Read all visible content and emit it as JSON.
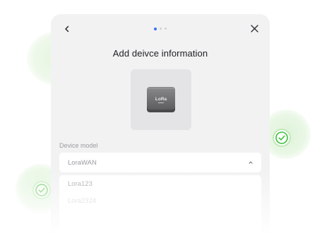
{
  "dialog": {
    "title": "Add deivce information",
    "steps": {
      "total": 3,
      "current": 1
    },
    "back_icon": "chevron-left-icon",
    "close_icon": "close-icon"
  },
  "device_image": {
    "chip_text": "LoRa",
    "colors": {
      "tile": "#e4e4e6",
      "chip": "#6b6b6e"
    }
  },
  "device_model": {
    "label": "Device model",
    "selected": "LoraWAN",
    "options": [
      "Lora123",
      "Lora2324"
    ]
  },
  "colors": {
    "accent": "#3d6df2",
    "success": "#3cbf3c",
    "card": "#f2f2f3"
  }
}
